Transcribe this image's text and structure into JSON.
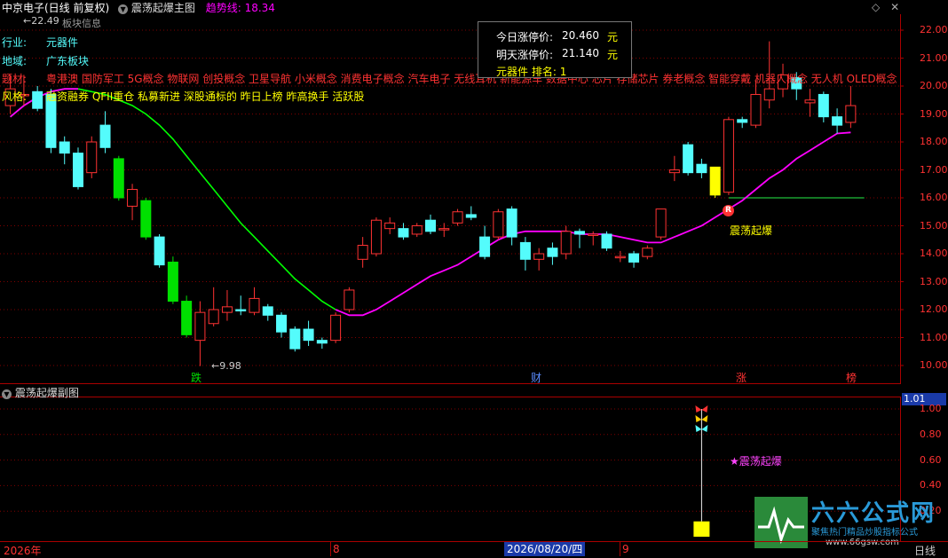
{
  "window": {
    "title": "中京电子(日线 前复权)",
    "indicator_name": "震荡起爆主图",
    "trend_label": "趋势线:",
    "trend_value": "18.34",
    "sub_title": "震荡起爆副图",
    "high_mark": "22.49",
    "low_mark": "9.98",
    "block_info": "板块信息"
  },
  "info": {
    "industry_label": "行业:",
    "industry_value": "元器件",
    "region_label": "地域:",
    "region_value": "广东板块",
    "theme_label": "题材:",
    "theme_value": "粤港澳 国防军工 5G概念 物联网 创投概念 卫星导航 小米概念 消费电子概念 汽车电子 无线耳机 新能源车 数据中心 芯片 存储芯片 券老概念 智能穿戴 机器人概念 无人机 OLED概念 Mini",
    "style_label": "风格:",
    "style_value": "融资融券 QFII重仓 私募新进 深股通标的 昨日上榜 昨高换手 活跃股"
  },
  "tooltip": {
    "today_label": "今日涨停价:",
    "today_value": "20.460",
    "today_unit": "元",
    "tomorrow_label": "明天涨停价:",
    "tomorrow_value": "21.140",
    "tomorrow_unit": "元",
    "rank_label": "元器件 排名:",
    "rank_value": "1"
  },
  "markers": {
    "die": "跌",
    "cai": "财",
    "zhang": "涨",
    "bang": "榜",
    "r_badge": "R",
    "signal_main": "震荡起爆",
    "signal_sub": "★震荡起爆"
  },
  "price_axis": [
    "22.00",
    "21.00",
    "20.00",
    "19.00",
    "18.00",
    "17.00",
    "16.00",
    "15.00",
    "14.00",
    "13.00",
    "12.00",
    "11.00",
    "10.00"
  ],
  "sub_axis": {
    "current": "1.01",
    "ticks": [
      "1.00",
      "0.80",
      "0.60",
      "0.40",
      "0.20"
    ]
  },
  "time_axis": {
    "year": "2026年",
    "m8": "8",
    "cursor_date": "2026/08/20/四",
    "m9": "9",
    "period": "日线"
  },
  "watermark": {
    "name": "六六公式网",
    "slogan": "聚焦热门精品炒股指标公式",
    "url": "www.66gsw.com"
  },
  "colors": {
    "up": "#ff3232",
    "down": "#54fcfc",
    "strong_down": "#00e000",
    "signal": "#ffff00",
    "trend_green": "#00ff00",
    "trend_magenta": "#ff00ff",
    "grid": "#800000"
  },
  "chart_data": {
    "type": "candlestick",
    "ylim": [
      9.6,
      22.5
    ],
    "candles": [
      {
        "o": 19.3,
        "c": 19.9,
        "h": 20.4,
        "l": 19.0,
        "t": "up"
      },
      {
        "o": 19.7,
        "c": 19.7,
        "h": 20.4,
        "l": 19.3,
        "t": "up"
      },
      {
        "o": 19.8,
        "c": 19.2,
        "h": 20.0,
        "l": 19.1,
        "t": "down"
      },
      {
        "o": 19.7,
        "c": 17.8,
        "h": 19.9,
        "l": 17.6,
        "t": "down"
      },
      {
        "o": 18.0,
        "c": 17.6,
        "h": 18.2,
        "l": 17.2,
        "t": "down"
      },
      {
        "o": 17.6,
        "c": 16.4,
        "h": 17.8,
        "l": 16.3,
        "t": "down"
      },
      {
        "o": 16.9,
        "c": 18.0,
        "h": 18.2,
        "l": 16.7,
        "t": "up"
      },
      {
        "o": 17.8,
        "c": 18.6,
        "h": 19.1,
        "l": 17.6,
        "t": "down"
      },
      {
        "o": 17.4,
        "c": 16.0,
        "h": 17.5,
        "l": 15.9,
        "t": "strong"
      },
      {
        "o": 15.7,
        "c": 16.3,
        "h": 16.5,
        "l": 15.2,
        "t": "up"
      },
      {
        "o": 15.9,
        "c": 14.6,
        "h": 16.0,
        "l": 14.5,
        "t": "strong"
      },
      {
        "o": 14.6,
        "c": 13.6,
        "h": 14.7,
        "l": 13.5,
        "t": "down"
      },
      {
        "o": 13.7,
        "c": 12.3,
        "h": 13.9,
        "l": 12.2,
        "t": "strong"
      },
      {
        "o": 12.3,
        "c": 11.1,
        "h": 12.5,
        "l": 11.0,
        "t": "strong"
      },
      {
        "o": 10.9,
        "c": 11.9,
        "h": 12.3,
        "l": 9.98,
        "t": "up"
      },
      {
        "o": 11.5,
        "c": 12.0,
        "h": 12.8,
        "l": 11.4,
        "t": "up"
      },
      {
        "o": 11.9,
        "c": 12.1,
        "h": 12.7,
        "l": 11.6,
        "t": "up"
      },
      {
        "o": 12.0,
        "c": 12.0,
        "h": 12.5,
        "l": 11.8,
        "t": "down"
      },
      {
        "o": 11.9,
        "c": 12.4,
        "h": 12.8,
        "l": 11.8,
        "t": "up"
      },
      {
        "o": 12.1,
        "c": 11.8,
        "h": 12.2,
        "l": 11.6,
        "t": "down"
      },
      {
        "o": 11.8,
        "c": 11.2,
        "h": 11.9,
        "l": 11.0,
        "t": "down"
      },
      {
        "o": 11.3,
        "c": 10.6,
        "h": 11.4,
        "l": 10.5,
        "t": "down"
      },
      {
        "o": 10.9,
        "c": 11.3,
        "h": 11.6,
        "l": 10.7,
        "t": "down"
      },
      {
        "o": 10.9,
        "c": 10.8,
        "h": 11.0,
        "l": 10.6,
        "t": "down"
      },
      {
        "o": 10.9,
        "c": 11.8,
        "h": 11.9,
        "l": 10.8,
        "t": "up"
      },
      {
        "o": 12.0,
        "c": 12.7,
        "h": 12.8,
        "l": 11.9,
        "t": "up"
      },
      {
        "o": 13.8,
        "c": 14.3,
        "h": 14.6,
        "l": 13.5,
        "t": "up"
      },
      {
        "o": 14.0,
        "c": 15.2,
        "h": 15.3,
        "l": 13.9,
        "t": "up"
      },
      {
        "o": 15.1,
        "c": 14.9,
        "h": 15.3,
        "l": 14.7,
        "t": "up"
      },
      {
        "o": 14.9,
        "c": 14.6,
        "h": 15.1,
        "l": 14.5,
        "t": "down"
      },
      {
        "o": 14.7,
        "c": 15.0,
        "h": 15.1,
        "l": 14.6,
        "t": "up"
      },
      {
        "o": 15.2,
        "c": 14.8,
        "h": 15.4,
        "l": 14.7,
        "t": "down"
      },
      {
        "o": 14.9,
        "c": 14.9,
        "h": 15.1,
        "l": 14.6,
        "t": "up"
      },
      {
        "o": 15.1,
        "c": 15.5,
        "h": 15.6,
        "l": 15.0,
        "t": "up"
      },
      {
        "o": 15.4,
        "c": 15.3,
        "h": 15.7,
        "l": 15.2,
        "t": "down"
      },
      {
        "o": 14.6,
        "c": 13.9,
        "h": 15.0,
        "l": 13.8,
        "t": "down"
      },
      {
        "o": 14.6,
        "c": 15.5,
        "h": 15.6,
        "l": 14.5,
        "t": "up"
      },
      {
        "o": 15.6,
        "c": 14.6,
        "h": 15.7,
        "l": 14.3,
        "t": "down"
      },
      {
        "o": 14.4,
        "c": 13.8,
        "h": 14.6,
        "l": 13.4,
        "t": "down"
      },
      {
        "o": 13.8,
        "c": 14.0,
        "h": 14.2,
        "l": 13.4,
        "t": "up"
      },
      {
        "o": 14.2,
        "c": 13.9,
        "h": 14.4,
        "l": 13.6,
        "t": "down"
      },
      {
        "o": 14.0,
        "c": 14.8,
        "h": 15.0,
        "l": 13.8,
        "t": "up"
      },
      {
        "o": 14.8,
        "c": 14.7,
        "h": 14.9,
        "l": 14.2,
        "t": "down"
      },
      {
        "o": 14.7,
        "c": 14.7,
        "h": 14.8,
        "l": 14.3,
        "t": "up"
      },
      {
        "o": 14.7,
        "c": 14.2,
        "h": 14.8,
        "l": 14.1,
        "t": "down"
      },
      {
        "o": 13.9,
        "c": 13.9,
        "h": 14.1,
        "l": 13.7,
        "t": "up"
      },
      {
        "o": 14.0,
        "c": 13.7,
        "h": 14.1,
        "l": 13.5,
        "t": "down"
      },
      {
        "o": 13.9,
        "c": 14.2,
        "h": 14.3,
        "l": 13.8,
        "t": "up"
      },
      {
        "o": 14.6,
        "c": 15.6,
        "h": 15.6,
        "l": 14.5,
        "t": "up"
      },
      {
        "o": 16.9,
        "c": 17.0,
        "h": 17.5,
        "l": 16.6,
        "t": "up"
      },
      {
        "o": 16.9,
        "c": 17.9,
        "h": 18.0,
        "l": 16.8,
        "t": "down"
      },
      {
        "o": 16.9,
        "c": 17.2,
        "h": 17.4,
        "l": 16.7,
        "t": "down"
      },
      {
        "o": 16.1,
        "c": 17.1,
        "h": 17.1,
        "l": 16.0,
        "t": "signal"
      },
      {
        "o": 16.2,
        "c": 18.8,
        "h": 18.9,
        "l": 16.1,
        "t": "up"
      },
      {
        "o": 18.8,
        "c": 18.7,
        "h": 18.9,
        "l": 18.5,
        "t": "down"
      },
      {
        "o": 18.6,
        "c": 19.7,
        "h": 20.2,
        "l": 18.5,
        "t": "up"
      },
      {
        "o": 19.5,
        "c": 19.9,
        "h": 21.6,
        "l": 19.2,
        "t": "up"
      },
      {
        "o": 19.9,
        "c": 20.4,
        "h": 20.8,
        "l": 19.6,
        "t": "up"
      },
      {
        "o": 20.3,
        "c": 19.9,
        "h": 20.5,
        "l": 19.5,
        "t": "down"
      },
      {
        "o": 19.4,
        "c": 19.5,
        "h": 19.9,
        "l": 18.9,
        "t": "up"
      },
      {
        "o": 19.7,
        "c": 18.9,
        "h": 19.8,
        "l": 18.7,
        "t": "down"
      },
      {
        "o": 18.9,
        "c": 18.6,
        "h": 19.2,
        "l": 18.3,
        "t": "down"
      },
      {
        "o": 18.7,
        "c": 19.3,
        "h": 20.0,
        "l": 18.5,
        "t": "up"
      }
    ],
    "trend_line": [
      18.9,
      19.3,
      19.6,
      19.8,
      19.9,
      19.9,
      19.8,
      19.7,
      19.5,
      19.3,
      19.0,
      18.6,
      18.1,
      17.5,
      16.9,
      16.3,
      15.7,
      15.1,
      14.6,
      14.1,
      13.6,
      13.1,
      12.7,
      12.3,
      12.0,
      11.8,
      11.8,
      12.0,
      12.3,
      12.6,
      12.9,
      13.2,
      13.4,
      13.6,
      13.9,
      14.2,
      14.5,
      14.7,
      14.8,
      14.8,
      14.8,
      14.8,
      14.7,
      14.7,
      14.7,
      14.6,
      14.5,
      14.4,
      14.4,
      14.6,
      14.8,
      15.0,
      15.3,
      15.6,
      15.9,
      16.3,
      16.7,
      17.0,
      17.4,
      17.7,
      18.0,
      18.3,
      18.34
    ],
    "trend_green_until": 24,
    "hline": {
      "value": 16.0,
      "from": 53,
      "to": 62
    },
    "sub_signal": {
      "index": 51,
      "value": 0.12,
      "line_to": 1.0
    }
  }
}
